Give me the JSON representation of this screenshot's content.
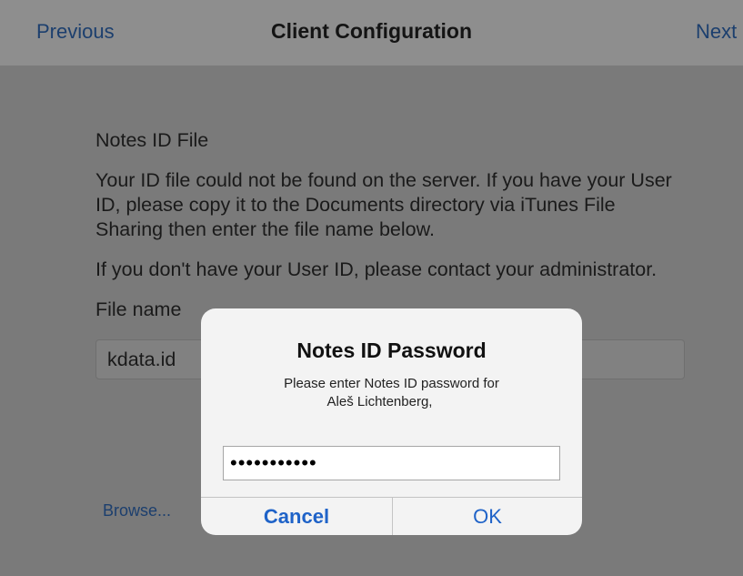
{
  "nav": {
    "previous_label": "Previous",
    "title": "Client Configuration",
    "next_label": "Next"
  },
  "content": {
    "section_title": "Notes ID File",
    "paragraph1": "Your ID file could not be found on the server. If you have your User ID, please copy it to the Documents directory via iTunes File Sharing then enter the file name below.",
    "paragraph2": "If you don't have your User ID, please contact your administrator.",
    "file_name_label": "File name",
    "file_name_value": "kdata.id",
    "browse_label": "Browse..."
  },
  "alert": {
    "title": "Notes ID Password",
    "message_line1": "Please enter Notes ID password for",
    "message_line2": "Aleš Lichtenberg,",
    "password_value": "•••••••••••",
    "cancel_label": "Cancel",
    "ok_label": "OK"
  },
  "colors": {
    "accent": "#1f63c8",
    "dimmed_link": "#1c3f6e",
    "dim_background": "#7a7a7a",
    "alert_background": "#f3f3f3"
  }
}
